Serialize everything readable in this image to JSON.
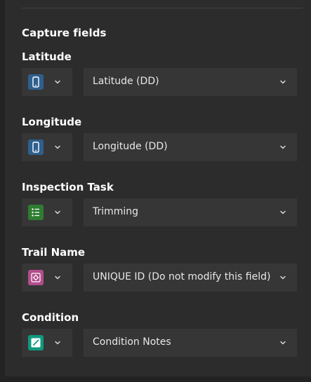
{
  "section": {
    "title": "Capture fields"
  },
  "fields": [
    {
      "label": "Latitude",
      "source_type_icon": "mobile-device-icon",
      "source_type_color": "#2f5f8f",
      "value": "Latitude (DD)"
    },
    {
      "label": "Longitude",
      "source_type_icon": "mobile-device-icon",
      "source_type_color": "#2f5f8f",
      "value": "Longitude (DD)"
    },
    {
      "label": "Inspection Task",
      "source_type_icon": "list-icon",
      "source_type_color": "#2e7d32",
      "value": "Trimming"
    },
    {
      "label": "Trail Name",
      "source_type_icon": "settings-gear-icon",
      "source_type_color": "#b34d8c",
      "value": "UNIQUE ID (Do not modify this field)"
    },
    {
      "label": "Condition",
      "source_type_icon": "edit-pencil-icon",
      "source_type_color": "#0e9a7f",
      "value": "Condition Notes"
    }
  ]
}
